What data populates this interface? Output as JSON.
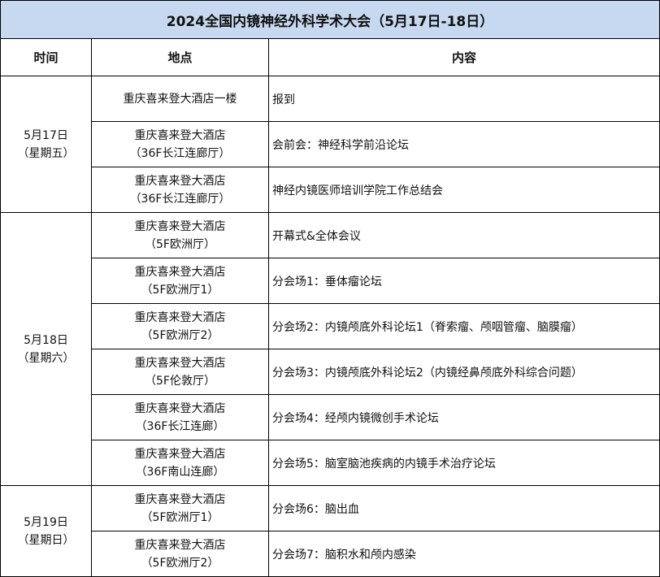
{
  "title": "2024全国内镜神经外科学术大会（5月17日-18日）",
  "headers": {
    "time": "时间",
    "location": "地点",
    "content": "内容"
  },
  "groups": [
    {
      "date": "5月17日",
      "weekday": "（星期五）",
      "rows": [
        {
          "loc1": "重庆喜来登大酒店一楼",
          "loc2": "",
          "content": "报到"
        },
        {
          "loc1": "重庆喜来登大酒店",
          "loc2": "（36F长江连廊厅）",
          "content": "会前会：神经科学前沿论坛"
        },
        {
          "loc1": "重庆喜来登大酒店",
          "loc2": "（36F长江连廊厅）",
          "content": "神经内镜医师培训学院工作总结会"
        }
      ]
    },
    {
      "date": "5月18日",
      "weekday": "（星期六）",
      "rows": [
        {
          "loc1": "重庆喜来登大酒店",
          "loc2": "（5F欧洲厅）",
          "content": "开幕式&全体会议"
        },
        {
          "loc1": "重庆喜来登大酒店",
          "loc2": "（5F欧洲厅1）",
          "content": "分会场1：垂体瘤论坛"
        },
        {
          "loc1": "重庆喜来登大酒店",
          "loc2": "（5F欧洲厅2）",
          "content": "分会场2：内镜颅底外科论坛1（脊索瘤、颅咽管瘤、脑膜瘤）"
        },
        {
          "loc1": "重庆喜来登大酒店",
          "loc2": "（5F伦敦厅）",
          "content": "分会场3：内镜颅底外科论坛2（内镜经鼻颅底外科综合问题）"
        },
        {
          "loc1": "重庆喜来登大酒店",
          "loc2": "（36F长江连廊）",
          "content": "分会场4：经颅内镜微创手术论坛"
        },
        {
          "loc1": "重庆喜来登大酒店",
          "loc2": "（36F南山连廊）",
          "content": "分会场5：脑室脑池疾病的内镜手术治疗论坛"
        }
      ]
    },
    {
      "date": "5月19日",
      "weekday": "（星期日）",
      "rows": [
        {
          "loc1": "重庆喜来登大酒店",
          "loc2": "（5F欧洲厅1）",
          "content": "分会场6：脑出血"
        },
        {
          "loc1": "重庆喜来登大酒店",
          "loc2": "（5F欧洲厅2）",
          "content": "分会场7：脑积水和颅内感染"
        }
      ]
    }
  ]
}
